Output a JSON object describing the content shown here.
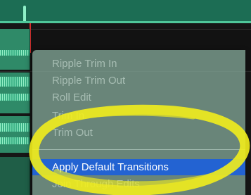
{
  "colors": {
    "ruler": "#1c6d54",
    "track": "#2f8a68",
    "playhead": "#d82c2c",
    "menu_background": "#82a596",
    "menu_disabled_text": "#a7bdb3",
    "selection": "#2363d2",
    "annotation": "#f2ee1c"
  },
  "context_menu": {
    "items": [
      {
        "label": "Ripple Trim In",
        "enabled": false
      },
      {
        "label": "Ripple Trim Out",
        "enabled": false
      },
      {
        "label": "Roll Edit",
        "enabled": false
      },
      {
        "label": "Trim In",
        "enabled": false
      },
      {
        "label": "Trim Out",
        "enabled": false
      },
      {
        "label": "Apply Default Transitions",
        "enabled": true,
        "selected": true
      },
      {
        "label": "Join Through Edits",
        "enabled": false
      }
    ]
  },
  "annotation": {
    "shape": "ellipse",
    "target": "Apply Default Transitions"
  }
}
